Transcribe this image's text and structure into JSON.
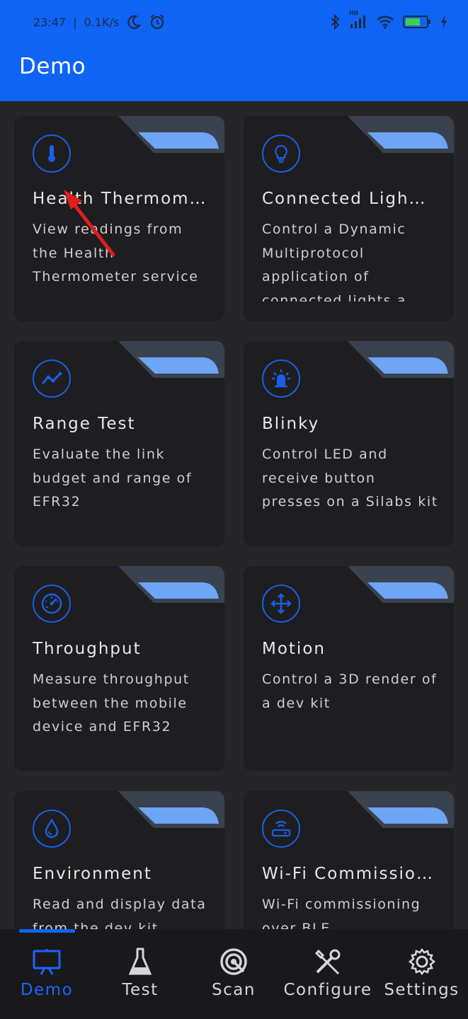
{
  "status_bar": {
    "time": "23:47",
    "separator": "|",
    "speed": "0.1K/s",
    "icons": [
      "moon-icon",
      "alarm-icon",
      "bluetooth-icon",
      "signal-icon",
      "wifi-icon",
      "battery-icon",
      "charging-icon"
    ],
    "network_badge": "HD"
  },
  "app_bar": {
    "title": "Demo"
  },
  "colors": {
    "accent": "#0f64f5",
    "icon_blue": "#1b5fe8",
    "card_bg": "#1e1e20",
    "page_bg": "#262628",
    "corner_light": "#6ea5f5",
    "corner_dark": "#3a4250"
  },
  "cards": [
    {
      "title": "Health Thermom…",
      "description": "View readings from the Health Thermometer service",
      "icon": "thermometer-icon"
    },
    {
      "title": "Connected Ligh…",
      "description": "Control a Dynamic Multiprotocol application of connected lights a…",
      "icon": "lightbulb-icon"
    },
    {
      "title": "Range Test",
      "description": "Evaluate the link budget and range of EFR32",
      "icon": "chart-line-icon"
    },
    {
      "title": "Blinky",
      "description": "Control LED and receive button presses on a Silabs kit",
      "icon": "led-icon"
    },
    {
      "title": "Throughput",
      "description": "Measure throughput between the mobile device and EFR32",
      "icon": "speedometer-icon"
    },
    {
      "title": "Motion",
      "description": "Control a 3D render of a dev kit",
      "icon": "move-arrows-icon"
    },
    {
      "title": "Environment",
      "description": "Read and display data from the dev kit sensors",
      "icon": "water-drop-icon"
    },
    {
      "title": "Wi-Fi Commissio…",
      "description": "Wi-Fi commissioning over BLE",
      "icon": "router-icon"
    }
  ],
  "bottom_nav": {
    "items": [
      {
        "label": "Demo",
        "icon": "monitor-icon",
        "active": true
      },
      {
        "label": "Test",
        "icon": "flask-icon",
        "active": false
      },
      {
        "label": "Scan",
        "icon": "scan-icon",
        "active": false
      },
      {
        "label": "Configure",
        "icon": "tools-icon",
        "active": false
      },
      {
        "label": "Settings",
        "icon": "gear-icon",
        "active": false
      }
    ]
  }
}
